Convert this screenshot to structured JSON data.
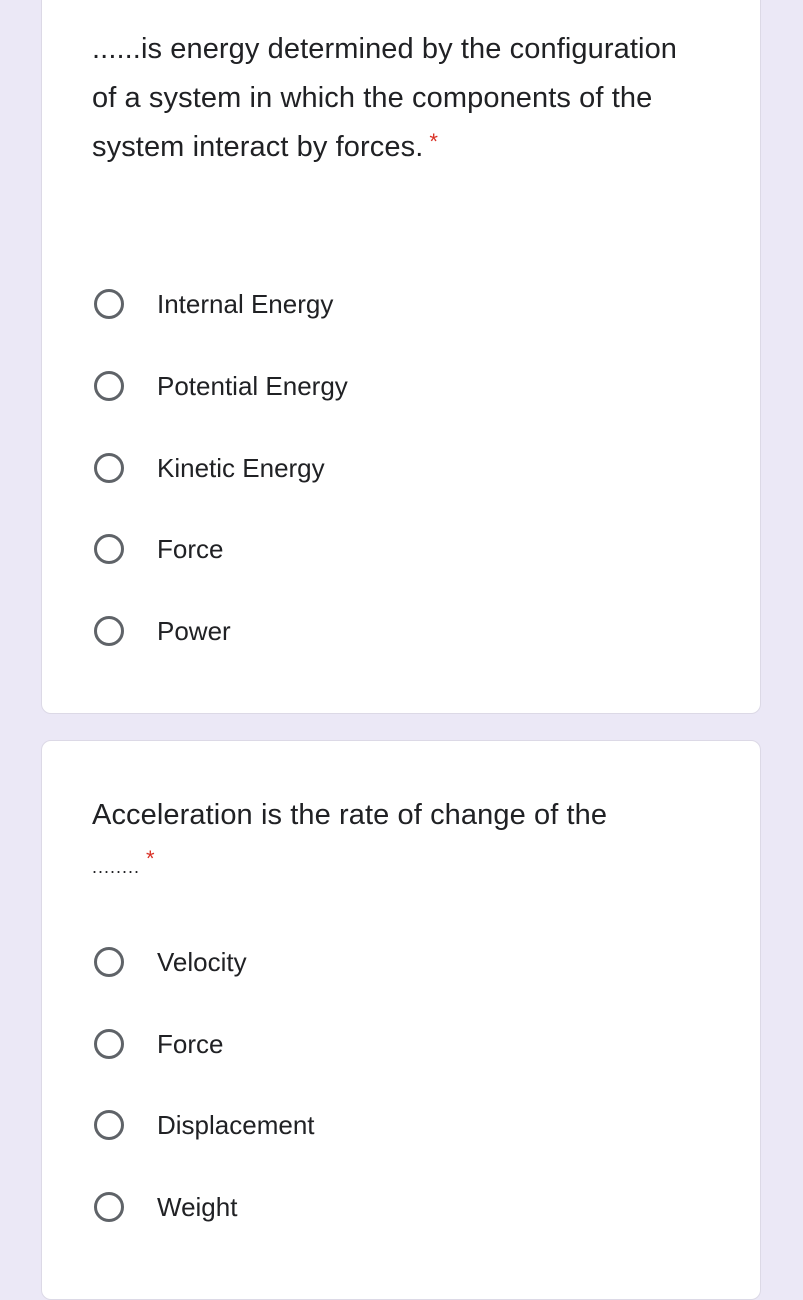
{
  "colors": {
    "background": "#ebe8f6",
    "card": "#ffffff",
    "required": "#d93025",
    "radio_border": "#5f6368"
  },
  "questions": [
    {
      "text": "......is energy determined by the configuration of a system in which the components of the system interact by forces.",
      "required_mark": "*",
      "options": [
        {
          "label": "Internal Energy",
          "selected": false
        },
        {
          "label": "Potential Energy",
          "selected": false
        },
        {
          "label": "Kinetic Energy",
          "selected": false
        },
        {
          "label": "Force",
          "selected": false
        },
        {
          "label": "Power",
          "selected": false
        }
      ]
    },
    {
      "text": "Acceleration is the rate of change of the",
      "blank": "........",
      "required_mark": "*",
      "options": [
        {
          "label": "Velocity",
          "selected": false
        },
        {
          "label": "Force",
          "selected": false
        },
        {
          "label": "Displacement",
          "selected": false
        },
        {
          "label": "Weight",
          "selected": false
        }
      ]
    }
  ]
}
